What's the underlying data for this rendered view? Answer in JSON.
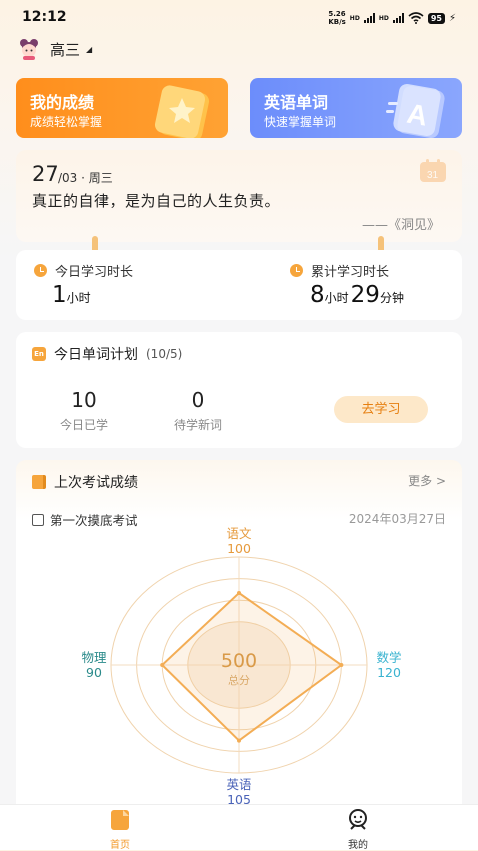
{
  "status": {
    "time": "12:12",
    "net_speed_value": "5.26",
    "net_speed_unit": "KB/s",
    "network": "HD",
    "battery": "95"
  },
  "header": {
    "grade": "高三"
  },
  "cards": [
    {
      "title": "我的成绩",
      "subtitle": "成绩轻松掌握",
      "color": "#ff9426"
    },
    {
      "title": "英语单词",
      "subtitle": "快速掌握单词",
      "color": "#7a98fc"
    }
  ],
  "quote": {
    "day": "27",
    "rest": "/03 · 周三",
    "text": "真正的自律，是为自己的人生负责。",
    "source": "——《洞见》"
  },
  "study_time": {
    "today_label": "今日学习时长",
    "today_hours": "1",
    "today_unit": "小时",
    "total_label": "累计学习时长",
    "total_hours": "8",
    "total_hours_unit": "小时",
    "total_minutes": "29",
    "total_minutes_unit": "分钟"
  },
  "word_plan": {
    "title": "今日单词计划",
    "count": "(10/5)",
    "learned_value": "10",
    "learned_label": "今日已学",
    "pending_value": "0",
    "pending_label": "待学新词",
    "button": "去学习"
  },
  "exam": {
    "section_title": "上次考试成绩",
    "more": "更多 >",
    "name": "第一次摸底考试",
    "date": "2024年03月27日",
    "total": "500",
    "total_label": "总分",
    "subjects": [
      {
        "name": "语文",
        "score": "100",
        "color": "#e69a3c"
      },
      {
        "name": "数学",
        "score": "120",
        "color": "#3ab3d0"
      },
      {
        "name": "英语",
        "score": "105",
        "color": "#4a63b8"
      },
      {
        "name": "物理",
        "score": "90",
        "color": "#2a8a8a"
      }
    ]
  },
  "chart_data": {
    "type": "radar",
    "categories": [
      "语文",
      "数学",
      "英语",
      "物理"
    ],
    "values": [
      100,
      120,
      105,
      90
    ],
    "max": 150,
    "center_label": "500",
    "center_sublabel": "总分"
  },
  "tabbar": {
    "home": "首页",
    "me": "我的",
    "accent": "#f39a2a"
  }
}
